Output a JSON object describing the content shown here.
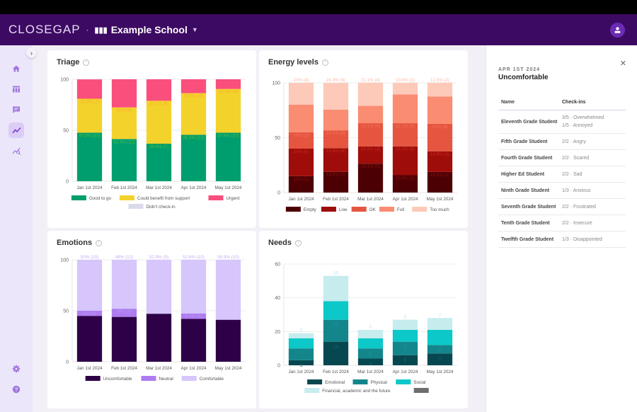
{
  "header": {
    "logo": "CLOSEGAP",
    "separator": "·",
    "school_name": "Example School",
    "school_icon": "building-chart-icon",
    "dropdown_icon": "chevron-down-icon",
    "avatar_icon": "user-icon",
    "brand_color": "#3d0a63"
  },
  "sidebar": {
    "expand_icon": "chevron-right-icon",
    "items": [
      {
        "name": "home",
        "icon": "home-icon",
        "glyph": "⌂",
        "active": false
      },
      {
        "name": "table",
        "icon": "table-icon",
        "glyph": "▤",
        "active": false
      },
      {
        "name": "messages",
        "icon": "chat-icon",
        "glyph": "▭",
        "active": false
      },
      {
        "name": "trends",
        "icon": "trending-icon",
        "glyph": "⟋",
        "active": true
      },
      {
        "name": "analytics",
        "icon": "analytics-icon",
        "glyph": "⌕",
        "active": false
      }
    ],
    "bottom_items": [
      {
        "name": "settings",
        "icon": "gear-icon",
        "glyph": "⚙"
      },
      {
        "name": "help",
        "icon": "help-icon",
        "glyph": "?"
      }
    ]
  },
  "chart_data": [
    {
      "id": "triage",
      "type": "bar",
      "stacked": true,
      "title": "Triage",
      "categories": [
        "Jan 1st 2024",
        "Feb 1st 2024",
        "Mar 1st 2024",
        "Apr 1st 2024",
        "May 1st 2024"
      ],
      "ylim": [
        0,
        100
      ],
      "yticks": [
        0,
        50,
        100
      ],
      "series": [
        {
          "name": "Good to go",
          "color": "#009e6e",
          "values": [
            47.6,
            41.4,
            36.8,
            45.5,
            47.6
          ],
          "labels": [
            "47.6% (10)",
            "41.4% (12)",
            "36.8% (7)",
            "45.5% (10)",
            "47.6% (10)"
          ],
          "label_color": "#5db83a"
        },
        {
          "name": "Could benefit from support",
          "color": "#f4d22c",
          "values": [
            33.3,
            31,
            42.1,
            40.9,
            42.9
          ],
          "labels": [
            "33.3% (7)",
            "31% (9)",
            "42.1% (8)",
            "40.9% (9)",
            "42.9% (9)"
          ],
          "label_color": "#f5b02a"
        },
        {
          "name": "Urgent",
          "color": "#fa4f7c",
          "values": [
            19,
            27.6,
            21.1,
            13.6,
            9.5
          ],
          "labels": [
            "19% (4)",
            "27.6% (8)",
            "21.1% (4)",
            "13.6% (3)",
            "9.5% (2)"
          ],
          "label_color": "#fa4f7c"
        },
        {
          "name": "Didn't check-in",
          "color": "#dcdaea",
          "values": [
            0,
            0,
            0,
            0,
            0
          ],
          "labels": [
            "",
            "",
            "",
            "",
            ""
          ],
          "label_color": "#aaa"
        }
      ],
      "legend": "bottom"
    },
    {
      "id": "energy",
      "type": "bar",
      "stacked": true,
      "title": "Energy levels",
      "categories": [
        "Jan 1st 2024",
        "Feb 1st 2024",
        "Mar 1st 2024",
        "Apr 1st 2024",
        "May 1st 2024"
      ],
      "ylim": [
        0,
        100
      ],
      "yticks": [
        0,
        50,
        100
      ],
      "series": [
        {
          "name": "Empty",
          "color": "#4d0003",
          "values": [
            15,
            18.9,
            26.3,
            15.8,
            18.8
          ],
          "labels": [
            "15% (3)",
            "18.9% (7)",
            "26.3% (5)",
            "15.8% (3)",
            "18.8% (3)"
          ],
          "label_color": "#8a1010"
        },
        {
          "name": "Low",
          "color": "#9e0d0a",
          "values": [
            25,
            21.6,
            15.8,
            26.3,
            18.8
          ],
          "labels": [
            "25% (5)",
            "21.6% (8)",
            "15.8% (3)",
            "26.3% (5)",
            "18.8% (3)"
          ],
          "label_color": "#c82a20"
        },
        {
          "name": "OK",
          "color": "#e65540",
          "values": [
            15,
            16.2,
            21.1,
            21.1,
            25
          ],
          "labels": [
            "15% (3)",
            "16.2% (6)",
            "21.1% (4)",
            "21.1% (4)",
            "25% (4)"
          ],
          "label_color": "#f07358"
        },
        {
          "name": "Full",
          "color": "#fa8c72",
          "values": [
            25,
            18.9,
            15.8,
            26.3,
            25
          ],
          "labels": [
            "25% (5)",
            "18.9% (7)",
            "15.8% (3)",
            "26.3% (5)",
            "25% (4)"
          ],
          "label_color": "#fa8c72"
        },
        {
          "name": "Too much",
          "color": "#fdc9b9",
          "values": [
            20,
            24.3,
            21.1,
            10.5,
            12.5
          ],
          "labels": [
            "20% (4)",
            "24.3% (9)",
            "21.1% (4)",
            "10.5% (2)",
            "12.5% (2)"
          ],
          "label_color": "#fbb8a6"
        }
      ],
      "legend": "bottom"
    },
    {
      "id": "emotions",
      "type": "bar",
      "stacked": true,
      "title": "Emotions",
      "categories": [
        "Jan 1st 2024",
        "Feb 1st 2024",
        "Mar 1st 2024",
        "Apr 1st 2024",
        "May 1st 2024"
      ],
      "ylim": [
        0,
        100
      ],
      "yticks": [
        0,
        50,
        100
      ],
      "series": [
        {
          "name": "Uncomfortable",
          "color": "#2e0048",
          "values": [
            45,
            44,
            47.1,
            42.1,
            41.2
          ],
          "labels": [
            "45% (9)",
            "44% (11)",
            "47.1% (8)",
            "42.1% (8)",
            "41.2% (7)"
          ],
          "label_color": "#2e0048"
        },
        {
          "name": "Neutral",
          "color": "#ae7cf0",
          "values": [
            5,
            8,
            0,
            5.3,
            0
          ],
          "labels": [
            "5% (1)",
            "8% (2)",
            "",
            "5.3% (1)",
            ""
          ],
          "label_color": "#b999f0"
        },
        {
          "name": "Comfortable",
          "color": "#d6c6fb",
          "values": [
            50,
            48,
            52.9,
            52.6,
            58.8
          ],
          "labels": [
            "50% (10)",
            "48% (12)",
            "52.9% (9)",
            "52.6% (10)",
            "58.8% (10)"
          ],
          "label_color": "#c4b0f5"
        }
      ],
      "legend": "bottom"
    },
    {
      "id": "needs",
      "type": "bar",
      "stacked": true,
      "title": "Needs",
      "categories": [
        "Jan 1st 2024",
        "Feb 1st 2024",
        "Mar 1st 2024",
        "Apr 1st 2024",
        "May 1st 2024"
      ],
      "ylim": [
        0,
        60
      ],
      "yticks": [
        0,
        20,
        40,
        60
      ],
      "series": [
        {
          "name": "Emotional",
          "color": "#074850",
          "values": [
            3,
            14,
            4,
            6,
            7
          ],
          "labels": [
            "3",
            "14",
            "4",
            "6",
            "7"
          ],
          "label_color": "#0b6b73"
        },
        {
          "name": "Physical",
          "color": "#13868c",
          "values": [
            7,
            13,
            6,
            8,
            5
          ],
          "labels": [
            "7",
            "13",
            "6",
            "8",
            "5"
          ],
          "label_color": "#139aa0"
        },
        {
          "name": "Social",
          "color": "#0cc8c8",
          "values": [
            6,
            11,
            6,
            7,
            9
          ],
          "labels": [
            "6",
            "11",
            "6",
            "7",
            "9"
          ],
          "label_color": "#1ad0d0"
        },
        {
          "name": "Financial, academic and the future",
          "color": "#c6ecee",
          "values": [
            3,
            15,
            5,
            6,
            7
          ],
          "labels": [
            "3",
            "15",
            "5",
            "6",
            "7"
          ],
          "label_color": "#b7e6ea"
        },
        {
          "name": "",
          "color": "#6e6e6e",
          "values": [
            0,
            0,
            0,
            0,
            0
          ],
          "labels": [
            "",
            "",
            "",
            "",
            ""
          ],
          "label_color": "#888"
        }
      ],
      "legend": "bottom"
    }
  ],
  "panel": {
    "date": "APR 1ST 2024",
    "title": "Uncomfortable",
    "close_icon": "close-icon",
    "columns": [
      "Name",
      "Check-ins"
    ],
    "rows": [
      {
        "name": "Eleventh Grade Student",
        "checkins": [
          "3/5 · Overwhelmed",
          "1/5 · Annoyed"
        ]
      },
      {
        "name": "Fifth Grade Student",
        "checkins": [
          "2/2 · Angry"
        ]
      },
      {
        "name": "Fourth Grade Student",
        "checkins": [
          "2/2 · Scared"
        ]
      },
      {
        "name": "Higher Ed Student",
        "checkins": [
          "2/2 · Sad"
        ]
      },
      {
        "name": "Ninth Grade Student",
        "checkins": [
          "1/3 · Anxious"
        ]
      },
      {
        "name": "Seventh Grade Student",
        "checkins": [
          "2/2 · Frustrated"
        ]
      },
      {
        "name": "Tenth Grade Student",
        "checkins": [
          "2/2 · Insecure"
        ]
      },
      {
        "name": "Twelfth Grade Student",
        "checkins": [
          "1/3 · Disappointed"
        ]
      }
    ]
  }
}
